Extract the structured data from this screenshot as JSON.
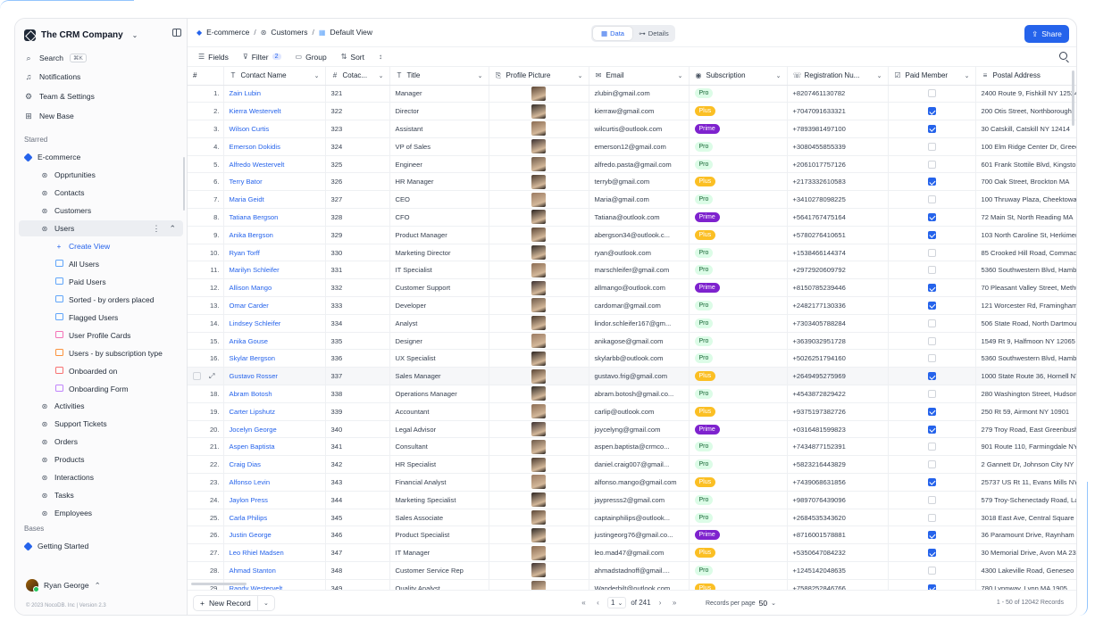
{
  "workspace": {
    "name": "The CRM Company"
  },
  "sidebar": {
    "search": {
      "label": "Search",
      "shortcut": "⌘K"
    },
    "notifications": "Notifications",
    "team_settings": "Team & Settings",
    "new_base": "New Base",
    "starred_label": "Starred",
    "starred_base": "E-commerce",
    "tables_top": [
      "Opprtunities",
      "Contacts",
      "Customers"
    ],
    "users_table": "Users",
    "create_view": "Create View",
    "views": [
      {
        "label": "All Users",
        "type": "grid"
      },
      {
        "label": "Paid Users",
        "type": "grid"
      },
      {
        "label": "Sorted - by orders placed",
        "type": "grid"
      },
      {
        "label": "Flagged Users",
        "type": "grid"
      },
      {
        "label": "User Profile Cards",
        "type": "card"
      },
      {
        "label": "Users - by subscription type",
        "type": "kanban"
      },
      {
        "label": "Onboarded on",
        "type": "cal"
      },
      {
        "label": "Onboarding Form",
        "type": "form"
      }
    ],
    "tables_bottom": [
      "Activities",
      "Support Tickets",
      "Orders",
      "Products",
      "Interactions",
      "Tasks",
      "Employees"
    ],
    "bases_label": "Bases",
    "bases": [
      "Getting Started"
    ],
    "user": "Ryan George",
    "copyright": "© 2023 NocoDB. Inc | Version 2.3"
  },
  "header": {
    "breadcrumb": [
      "E-commerce",
      "Customers",
      "Default View"
    ],
    "tabs": [
      "Data",
      "Details"
    ],
    "share_label": "Share"
  },
  "toolbar": {
    "fields": "Fields",
    "filter": "Filter",
    "filter_count": "2",
    "group": "Group",
    "sort": "Sort"
  },
  "columns": [
    "#",
    "Contact Name",
    "Cotac...",
    "Title",
    "Profile Picture",
    "Email",
    "Subscription",
    "Registration Nu...",
    "Paid Member",
    "Postal Address"
  ],
  "rows": [
    [
      "1.",
      "Zain Lubin",
      "321",
      "Manager",
      "zlubin@gmail.com",
      "Pro",
      "+8207461130782",
      false,
      "2400 Route 9, Fishkill NY 12524"
    ],
    [
      "2.",
      "Kierra Westervelt",
      "322",
      "Director",
      "kierraw@gmail.com",
      "Plus",
      "+7047091633321",
      true,
      "200 Otis Street, Northborough"
    ],
    [
      "3.",
      "Wilson Curtis",
      "323",
      "Assistant",
      "wilcurtis@outlook.com",
      "Prime",
      "+7893981497100",
      true,
      "30 Catskill, Catskill NY 12414"
    ],
    [
      "4.",
      "Emerson Dokidis",
      "324",
      "VP of Sales",
      "emerson12@gmail.com",
      "Pro",
      "+3080455855339",
      false,
      "100 Elm Ridge Center Dr, Greece"
    ],
    [
      "5.",
      "Alfredo Westervelt",
      "325",
      "Engineer",
      "alfredo.pasta@gmail.com",
      "Pro",
      "+2061017757126",
      false,
      "601 Frank Stottile Blvd, Kingston"
    ],
    [
      "6.",
      "Terry Bator",
      "326",
      "HR Manager",
      "terryb@gmail.com",
      "Plus",
      "+2173332610583",
      true,
      "700 Oak Street, Brockton MA"
    ],
    [
      "7.",
      "Maria Geidt",
      "327",
      "CEO",
      "Maria@gmail.com",
      "Pro",
      "+3410278098225",
      false,
      "100 Thruway Plaza, Cheektowaga"
    ],
    [
      "8.",
      "Tatiana Bergson",
      "328",
      "CFO",
      "Tatiana@outlook.com",
      "Prime",
      "+5641767475164",
      true,
      "72 Main St, North Reading MA"
    ],
    [
      "9.",
      "Anika Bergson",
      "329",
      "Product Manager",
      "abergson34@outlook.c...",
      "Plus",
      "+5780276410651",
      true,
      "103 North Caroline St, Herkimer"
    ],
    [
      "10.",
      "Ryan Torff",
      "330",
      "Marketing Director",
      "ryan@outlook.com",
      "Pro",
      "+1538466144374",
      false,
      "85 Crooked Hill Road, Commack"
    ],
    [
      "11.",
      "Marilyn Schleifer",
      "331",
      "IT Specialist",
      "marschleifer@gmail.com",
      "Pro",
      "+2972920609792",
      false,
      "5360 Southwestern Blvd, Hamburg"
    ],
    [
      "12.",
      "Allison Mango",
      "332",
      "Customer Support",
      "allmango@outlook.com",
      "Prime",
      "+8150785239446",
      true,
      "70 Pleasant Valley Street, Methuen"
    ],
    [
      "13.",
      "Omar Carder",
      "333",
      "Developer",
      "cardomar@gmail.com",
      "Pro",
      "+2482177130336",
      true,
      "121 Worcester Rd, Framingham"
    ],
    [
      "14.",
      "Lindsey Schleifer",
      "334",
      "Analyst",
      "lindor.schleifer167@gm...",
      "Pro",
      "+7303405788284",
      false,
      "506 State Road, North Dartmouth"
    ],
    [
      "15.",
      "Anika Gouse",
      "335",
      "Designer",
      "anikagose@gmail.com",
      "Pro",
      "+3639032951728",
      false,
      "1549 Rt 9, Halfmoon NY 12065"
    ],
    [
      "16.",
      "Skylar Bergson",
      "336",
      "UX Specialist",
      "skylarbb@outlook.com",
      "Pro",
      "+5026251794160",
      false,
      "5360 Southwestern Blvd, Hamburg"
    ],
    [
      "",
      "Gustavo Rosser",
      "337",
      "Sales Manager",
      "gustavo.frig@gmail.com",
      "Plus",
      "+2649495275969",
      true,
      "1000 State Route 36, Hornell NY"
    ],
    [
      "18.",
      "Abram Botosh",
      "338",
      "Operations Manager",
      "abram.botosh@gmail.co...",
      "Pro",
      "+4543872829422",
      false,
      "280 Washington Street, Hudson"
    ],
    [
      "19.",
      "Carter Lipshutz",
      "339",
      "Accountant",
      "carlip@outlook.com",
      "Plus",
      "+9375197382726",
      true,
      "250 Rt 59, Airmont NY 10901"
    ],
    [
      "20.",
      "Jocelyn George",
      "340",
      "Legal Advisor",
      "joycelyng@gmail.com",
      "Prime",
      "+0316481599823",
      true,
      "279 Troy Road, East Greenbush"
    ],
    [
      "21.",
      "Aspen Baptista",
      "341",
      "Consultant",
      "aspen.baptista@crmco...",
      "Pro",
      "+7434877152391",
      false,
      "901 Route 110, Farmingdale NY"
    ],
    [
      "22.",
      "Craig Dias",
      "342",
      "HR Specialist",
      "daniel.craig007@gmail...",
      "Pro",
      "+5823216443829",
      false,
      "2 Gannett Dr, Johnson City NY"
    ],
    [
      "23.",
      "Alfonso Levin",
      "343",
      "Financial Analyst",
      "alfonso.mango@gmail.com",
      "Plus",
      "+7439068631856",
      true,
      "25737 US Rt 11, Evans Mills NY"
    ],
    [
      "24.",
      "Jaylon Press",
      "344",
      "Marketing Specialist",
      "jaypresss2@gmail.com",
      "Pro",
      "+9897076439096",
      false,
      "579 Troy-Schenectady Road, Latham"
    ],
    [
      "25.",
      "Carla Philips",
      "345",
      "Sales Associate",
      "captainphilips@outlook...",
      "Pro",
      "+2684535343620",
      false,
      "3018 East Ave, Central Square"
    ],
    [
      "26.",
      "Justin George",
      "346",
      "Product Specialist",
      "justingeorg76@gmail.co...",
      "Prime",
      "+8716001578881",
      true,
      "36 Paramount Drive, Raynham"
    ],
    [
      "27.",
      "Leo Rhiel Madsen",
      "347",
      "IT Manager",
      "leo.mad47@gmail.com",
      "Plus",
      "+5350647084232",
      true,
      "30 Memorial Drive, Avon MA 2322"
    ],
    [
      "28.",
      "Ahmad Stanton",
      "348",
      "Customer Service Rep",
      "ahmadstadnoff@gmail....",
      "Pro",
      "+1245142048635",
      false,
      "4300 Lakeville Road, Geneseo"
    ],
    [
      "29.",
      "Randy Westervelt",
      "349",
      "Quality Analyst",
      "Wanderbilt@outlook.com",
      "Plus",
      "+7588252846766",
      true,
      "780 Lynnway, Lynn MA 1905"
    ]
  ],
  "footer": {
    "new_record": "New Record",
    "page": "1",
    "of_pages": "of 241",
    "rpp_label": "Records per page",
    "rpp_value": "50",
    "count": "1 - 50 of 12042 Records"
  },
  "colors": {
    "accent": "#2563eb",
    "pro": "#dcfce7",
    "plus": "#fbbf24",
    "prime": "#7e22ce"
  }
}
